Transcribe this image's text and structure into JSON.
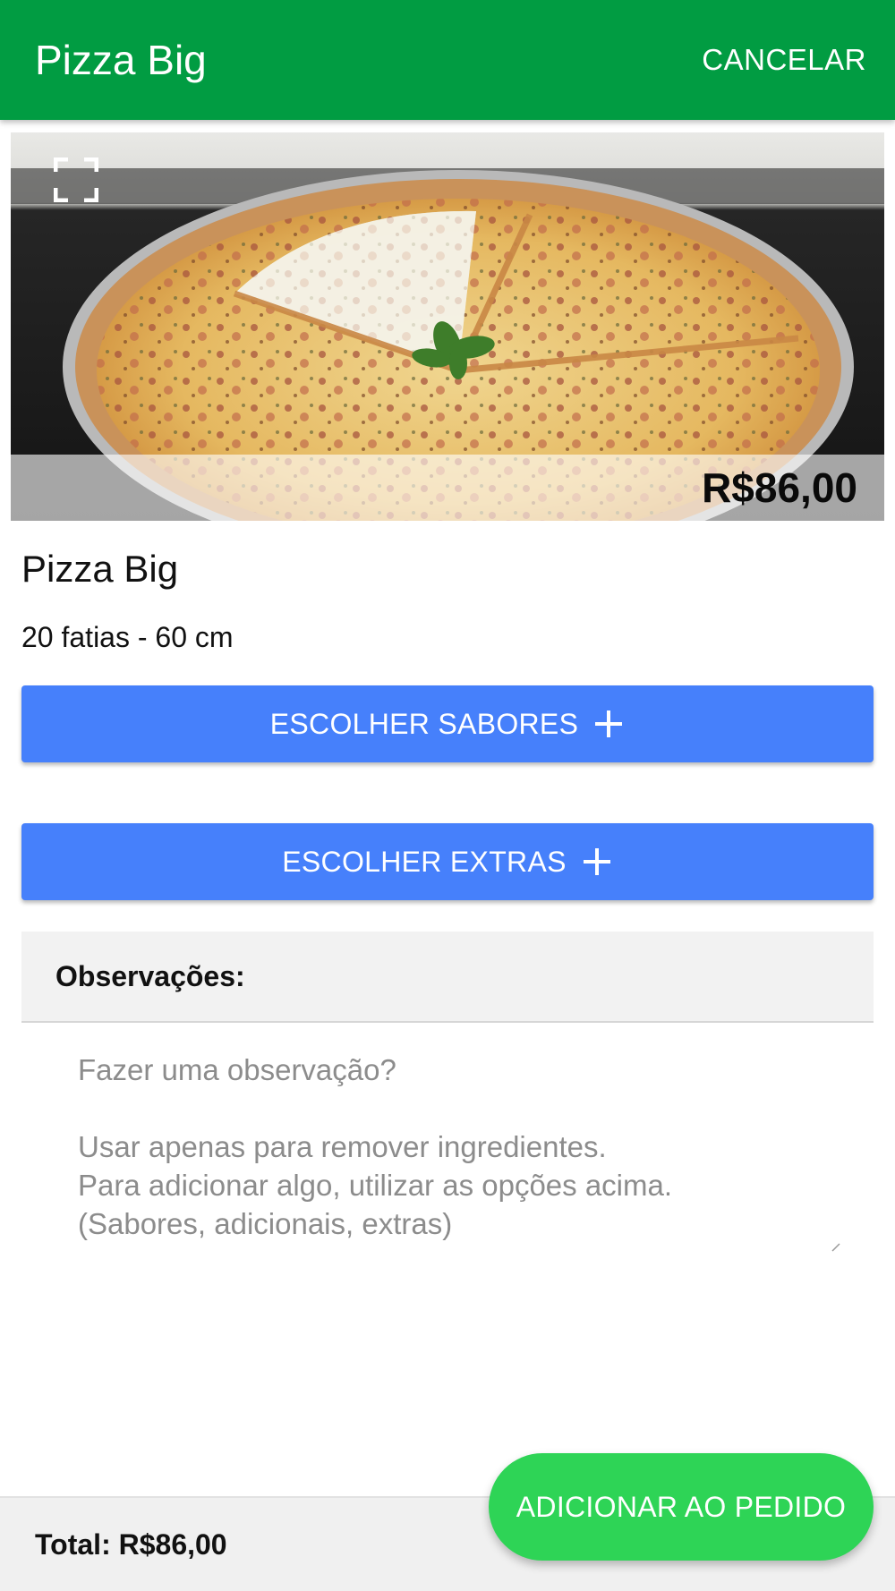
{
  "appbar": {
    "title": "Pizza Big",
    "cancel_label": "CANCELAR",
    "color": "#019c42"
  },
  "hero": {
    "image_alt": "pizza-photo",
    "expand_icon": "fullscreen-expand-icon",
    "price": "R$86,00"
  },
  "product": {
    "name": "Pizza Big",
    "description": "20 fatias - 60 cm"
  },
  "buttons": {
    "flavors_label": "ESCOLHER SABORES",
    "extras_label": "ESCOLHER EXTRAS",
    "icon": "plus-icon",
    "color": "#4680fb"
  },
  "notes": {
    "label": "Observações:",
    "placeholder": "Fazer uma observação?\n\nUsar apenas para remover ingredientes.\nPara adicionar algo, utilizar as opções acima.\n(Sabores, adicionais, extras)"
  },
  "footer": {
    "total": "Total: R$86,00",
    "add_label": "ADICIONAR AO PEDIDO",
    "add_color": "#2ed456"
  }
}
